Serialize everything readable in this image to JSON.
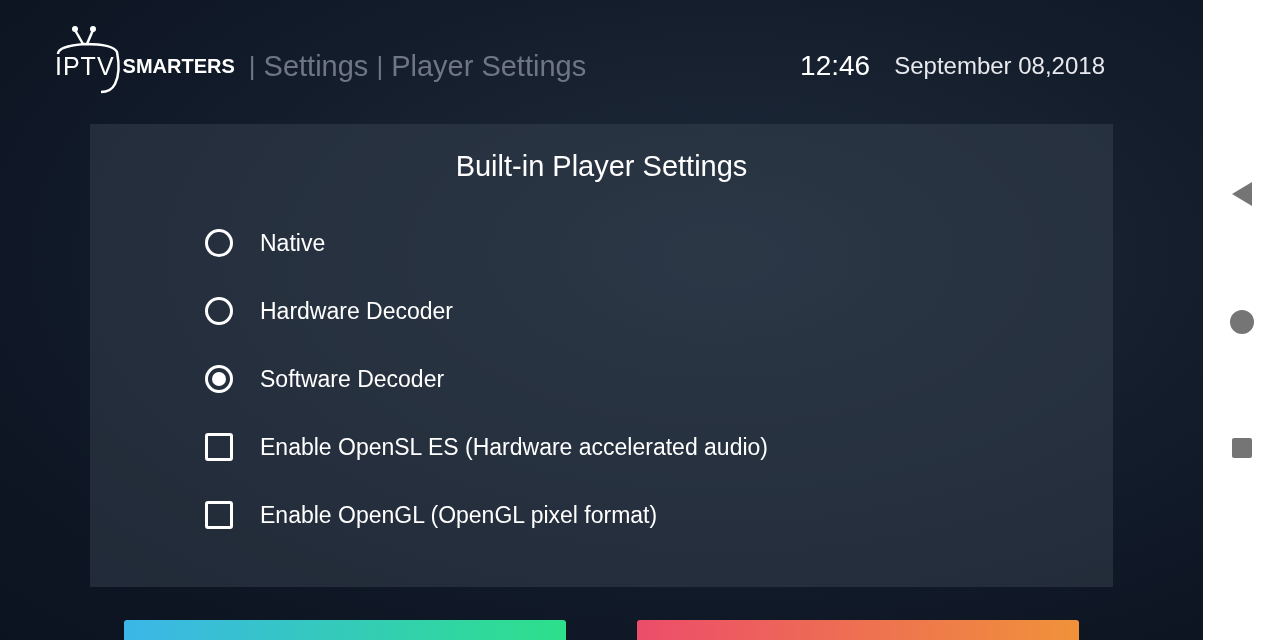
{
  "header": {
    "logo": {
      "part_1": "IPTV",
      "part_2": "SMARTERS"
    },
    "separator_1": "|",
    "crumb_1": "Settings",
    "separator_2": "|",
    "crumb_2": "Player Settings",
    "time": "12:46",
    "date": "September 08,2018"
  },
  "panel": {
    "title": "Built-in Player Settings",
    "options": [
      {
        "kind": "radio",
        "label": "Native",
        "selected": false
      },
      {
        "kind": "radio",
        "label": "Hardware Decoder",
        "selected": false
      },
      {
        "kind": "radio",
        "label": "Software Decoder",
        "selected": true
      },
      {
        "kind": "checkbox",
        "label": "Enable OpenSL ES (Hardware accelerated audio)",
        "checked": false
      },
      {
        "kind": "checkbox",
        "label": "Enable OpenGL (OpenGL pixel format)",
        "checked": false
      }
    ]
  }
}
